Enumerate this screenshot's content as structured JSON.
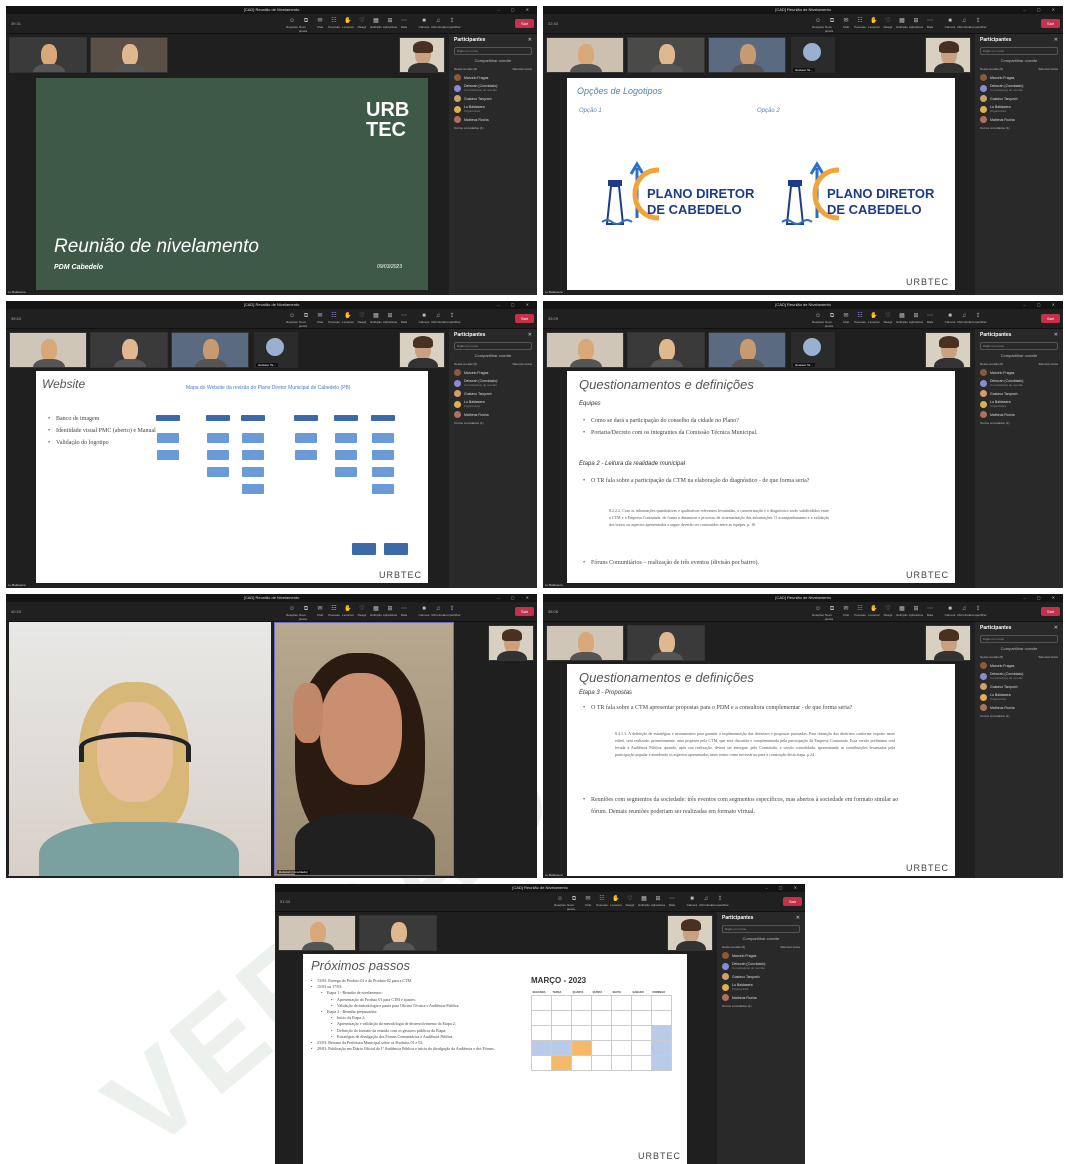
{
  "app": {
    "window_title": "[CAD] Reunião de Nivelamento",
    "leave_label": "Sair"
  },
  "controls": {
    "items": [
      "Reações",
      "Novo janela",
      "Chat",
      "Pessoas",
      "Levantar",
      "Reagir",
      "Exibição",
      "Aplicativos",
      "Mais",
      "Câmera",
      "Microfone",
      "Compartilhar"
    ]
  },
  "participants_panel": {
    "title": "Participantes",
    "search_placeholder": "Digite um nome",
    "share_invite": "Compartilhar convite",
    "in_meeting": "Nesta reunião (5)",
    "mute_all": "Silenciar todos",
    "others_invited": "Outros convidados (1)",
    "people": [
      {
        "name": "Marcelo Fragas",
        "role": "",
        "color": "#8a5a3c"
      },
      {
        "name": "Deborah (Convidado)",
        "role": "Convidado(a) de reunião",
        "color": "#8a8ad0"
      },
      {
        "name": "Gustavo Tarqurch",
        "role": "",
        "color": "#d0a06a"
      },
      {
        "name": "Lu Baldasera",
        "role": "Organizador",
        "color": "#e0b050"
      },
      {
        "name": "Matheus Rocha",
        "role": "",
        "color": "#b07060"
      }
    ]
  },
  "screens": [
    {
      "time": "39:31",
      "footer": "Lu Baldasera",
      "slide_title": "Reunião de nivelamento",
      "slide_sub": "PDM Cabedelo",
      "slide_date": "09/03/2023",
      "brand": "URB TEC"
    },
    {
      "time": "22:43",
      "footer": "Lu Baldasera",
      "thumb_name": "Gustavo Ta...",
      "slide_title": "Opções de Logotipos",
      "opt1": "Opção 1",
      "opt2": "Opção 2",
      "logo_line1": "PLANO DIRETOR",
      "logo_line2": "DE CABEDELO",
      "brand": "URBTEC"
    },
    {
      "time": "39:43",
      "footer": "Lu Baldasera",
      "thumb_name": "Gustavo Ta...",
      "slide_title": "Website",
      "map_title": "Mapa do Website da revisão do Plano Diretor Municipal de Cabedelo (PB)",
      "bullets": [
        "Banco de imagem",
        "Identidade visual PMC (aberto) e Manual",
        "Validação do logotipo"
      ],
      "brand": "URBTEC"
    },
    {
      "time": "35:29",
      "footer": "Lu Baldasera",
      "thumb_name": "Gustavo Ta...",
      "slide_title": "Questionamentos e definições",
      "sub1": "Equipes",
      "b1": "Como se dará a participação do conselho da cidade no Plano?",
      "b2": "Portaria/Decreto com os integrantes da Comissão Técnica Municipal.",
      "sub2": "Etapa 2 - Leitura da realidade municipal",
      "b3": "O TR fala sobre a participação da CTM na elaboração do diagnóstico - de que forma seria?",
      "quote": "8.2.2.2. Com as informações quantitativas e qualitativas relevantes levantadas, a caracterização e o diagnóstico serão subdivididos entre a CTM e a Empresa Contratada, de forma a dinamizar o processo de sistematização das informações. O acompanhamento e a validação dos textos ou aspectos apresentados a seguir deverão ser construídos entre as equipes. p. 16",
      "b4": "Fóruns Comunitários – realização de três eventos (divisão por bairro).",
      "brand": "URBTEC"
    },
    {
      "time": "40:43",
      "footer": "Lu Baldasera",
      "video_name": "Deborah (Convidado)"
    },
    {
      "time": "38:08",
      "footer": "Lu Baldasera",
      "slide_title": "Questionamentos e definições",
      "sub1": "Etapa 3 - Propostas",
      "b1": "O TR fala sobre a CTM apresentar propostas para o PDM e a consultora complementar - de que forma seria?",
      "quote": "8.4.1.3. A definição de estratégias e instrumentos para garantir a implementação das diretrizes e propostas pactuadas. Para obtenção das diretrizes conforme exposto neste edital, será realizado, primeiramente, uma proposta pela CTM, que será discutida e complementada pela participação da Empresa Contratada. Essa versão preliminar será levada à Audiência Pública, quando, após sua realização, deverá ser entregue, pela Contratada, a versão consolidada, apresentando as contribuições levantadas pela participação popular e atendendo os aspectos apresentados neste termo como necessários para a construção desta etapa. p.24",
      "b2": "Reuniões com segmentos da sociedade: três eventos com segmentos específicos, mas abertos à sociedade em formato similar ao fórum. Demais reuniões poderiam ser realizadas em formato virtual.",
      "brand": "URBTEC"
    },
    {
      "time": "51:33",
      "slide_title": "Próximos passos",
      "cal_title": "MARÇO - 2023",
      "bullets": [
        "13/03: Entrega do Produto 01 e do Produto 02 para a CTM.",
        "15/03 ou 17/03:",
        "Etapa 1 - Reunião de nivelamento:",
        "Apresentação do Produto 01 para CTM e ajustes;",
        "Validação da metodologia e pauta para Oficina Técnica e Audiência Pública.",
        "Etapa 2 - Reunião preparatória:",
        "Início da Etapa 2;",
        "Apresentação e validação da metodologia de desenvolvimento da Etapa 2;",
        "Definição do formato da reunião com os gestores públicos da Etapa;",
        "Estratégias de divulgação dos Fóruns Comunitários e Audiência Pública.",
        "23/03: Retorno da Prefeitura Municipal sobre os Produtos 01 e 02;",
        "29/03: Publicação em Diário Oficial da 1ª Audiência Pública e início da divulgação da Audiência e dos Fóruns."
      ],
      "days": [
        "SEGUNDA",
        "TERÇA",
        "QUARTA",
        "QUINTA",
        "SEXTA",
        "SÁBADO",
        "DOMINGO"
      ],
      "brand": "URBTEC"
    }
  ],
  "colors": {
    "teams_bg": "#1f1f1f",
    "slide_green": "#3e5a46",
    "leave_red": "#c4314b",
    "logo_blue": "#1e3a8a",
    "logo_orange": "#f2a33a",
    "cal_blue": "#b9cbe8",
    "cal_orange": "#f5b96a"
  }
}
